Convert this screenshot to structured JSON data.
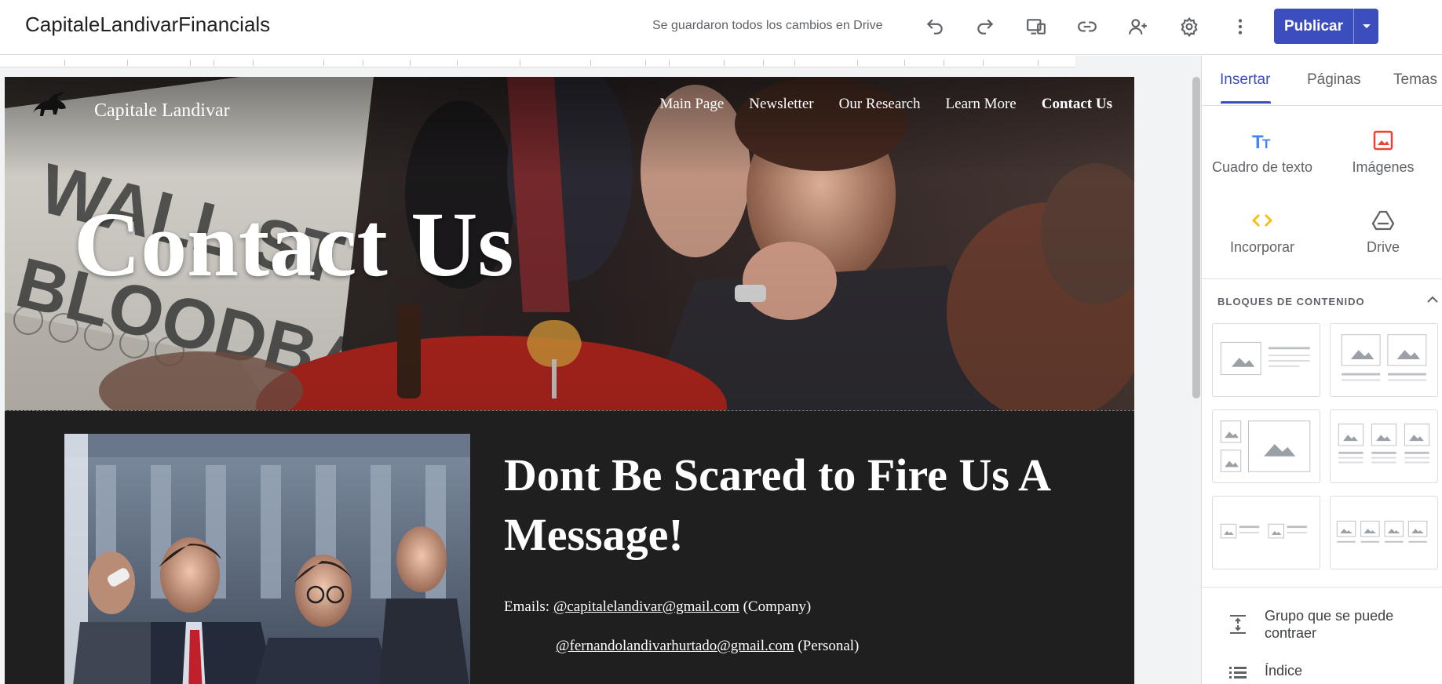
{
  "app": {
    "doc_title": "CapitaleLandivarFinancials",
    "save_status": "Se guardaron todos los cambios en Drive",
    "publish_label": "Publicar"
  },
  "toolbar": {
    "icons": [
      "undo-icon",
      "redo-icon",
      "preview-icon",
      "link-icon",
      "share-icon",
      "settings-icon",
      "more-icon"
    ]
  },
  "site": {
    "brand_name": "Capitale Landivar",
    "nav": [
      "Main Page",
      "Newsletter",
      "Our Research",
      "Learn More",
      "Contact Us"
    ],
    "active_nav": "Contact Us",
    "hero_title": "Contact Us",
    "heading": "Dont Be Scared to Fire Us A Message!",
    "emails_label": "Emails:",
    "email_company": "@capitalelandivar@gmail.com",
    "email_company_note": "(Company)",
    "email_personal": "@fernandolandivarhurtado@gmail.com",
    "email_personal_note": "(Personal)"
  },
  "panel": {
    "tabs": [
      "Insertar",
      "Páginas",
      "Temas"
    ],
    "active_tab": "Insertar",
    "insert_items": [
      {
        "label": "Cuadro de texto",
        "icon": "text-box-icon"
      },
      {
        "label": "Imágenes",
        "icon": "images-icon"
      },
      {
        "label": "Incorporar",
        "icon": "embed-icon"
      },
      {
        "label": "Drive",
        "icon": "drive-icon"
      }
    ],
    "blocks_header": "BLOQUES DE CONTENIDO",
    "list_items": [
      {
        "label": "Grupo que se puede contraer",
        "icon": "collapsible-group-icon"
      },
      {
        "label": "Índice",
        "icon": "table-of-contents-icon"
      }
    ]
  },
  "colors": {
    "accent": "#3c4dbd",
    "page_bg": "#1f1f1f",
    "image_red": "#ea4335",
    "embed_yellow": "#fbbc04"
  }
}
